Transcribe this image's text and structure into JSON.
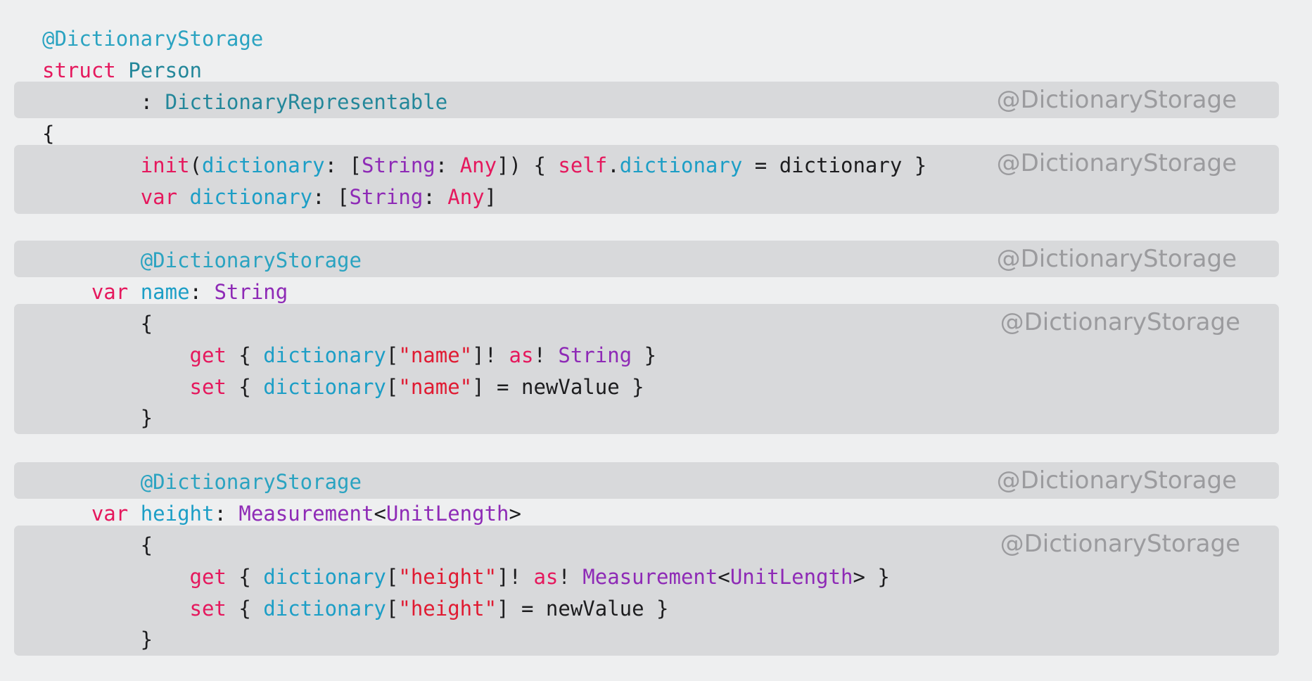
{
  "annotation_label": "@DictionaryStorage",
  "colors": {
    "background": "#eeeff0",
    "band": "#d8d9db",
    "attribute": "#2aa3c1",
    "keyword": "#e5185d",
    "type": "#23879a",
    "property": "#1c9ec6",
    "stdlib_type": "#8e2ab6",
    "string": "#e01b32",
    "plain": "#1d1d1f",
    "annotation": "#9b9b9e"
  },
  "bands": [
    {
      "name": "conformance-band",
      "tag": "@DictionaryStorage"
    },
    {
      "name": "members-band",
      "tag": "@DictionaryStorage"
    },
    {
      "name": "name-attribute-band",
      "tag": "@DictionaryStorage"
    },
    {
      "name": "name-accessor-band",
      "tag": "@DictionaryStorage"
    },
    {
      "name": "height-attribute-band",
      "tag": "@DictionaryStorage"
    },
    {
      "name": "height-accessor-band",
      "tag": "@DictionaryStorage"
    }
  ],
  "lines": [
    {
      "name": "line-attribute",
      "tokens": [
        {
          "t": "@DictionaryStorage",
          "k": "attr"
        }
      ]
    },
    {
      "name": "line-struct-decl",
      "tokens": [
        {
          "t": "struct",
          "k": "kw"
        },
        {
          "t": " ",
          "k": "plain"
        },
        {
          "t": "Person",
          "k": "type"
        }
      ]
    },
    {
      "name": "line-conformance",
      "tokens": [
        {
          "t": "        : ",
          "k": "plain"
        },
        {
          "t": "DictionaryRepresentable",
          "k": "type"
        }
      ]
    },
    {
      "name": "line-open-brace",
      "tokens": [
        {
          "t": "{",
          "k": "plain"
        }
      ]
    },
    {
      "name": "line-init",
      "tokens": [
        {
          "t": "        ",
          "k": "plain"
        },
        {
          "t": "init",
          "k": "kw"
        },
        {
          "t": "(",
          "k": "plain"
        },
        {
          "t": "dictionary",
          "k": "prop"
        },
        {
          "t": ": [",
          "k": "plain"
        },
        {
          "t": "String",
          "k": "std"
        },
        {
          "t": ": ",
          "k": "plain"
        },
        {
          "t": "Any",
          "k": "kw"
        },
        {
          "t": "]) { ",
          "k": "plain"
        },
        {
          "t": "self",
          "k": "kw"
        },
        {
          "t": ".",
          "k": "plain"
        },
        {
          "t": "dictionary",
          "k": "prop"
        },
        {
          "t": " = dictionary }",
          "k": "plain"
        }
      ]
    },
    {
      "name": "line-var-dictionary",
      "tokens": [
        {
          "t": "        ",
          "k": "plain"
        },
        {
          "t": "var",
          "k": "kw"
        },
        {
          "t": " ",
          "k": "plain"
        },
        {
          "t": "dictionary",
          "k": "prop"
        },
        {
          "t": ": [",
          "k": "plain"
        },
        {
          "t": "String",
          "k": "std"
        },
        {
          "t": ": ",
          "k": "plain"
        },
        {
          "t": "Any",
          "k": "kw"
        },
        {
          "t": "]",
          "k": "plain"
        }
      ]
    },
    {
      "name": "line-name-attribute",
      "tokens": [
        {
          "t": "        ",
          "k": "plain"
        },
        {
          "t": "@DictionaryStorage",
          "k": "attr"
        }
      ]
    },
    {
      "name": "line-var-name",
      "tokens": [
        {
          "t": "    ",
          "k": "plain"
        },
        {
          "t": "var",
          "k": "kw"
        },
        {
          "t": " ",
          "k": "plain"
        },
        {
          "t": "name",
          "k": "prop"
        },
        {
          "t": ": ",
          "k": "plain"
        },
        {
          "t": "String",
          "k": "std"
        }
      ]
    },
    {
      "name": "line-name-open",
      "tokens": [
        {
          "t": "        {",
          "k": "plain"
        }
      ]
    },
    {
      "name": "line-name-get",
      "tokens": [
        {
          "t": "            ",
          "k": "plain"
        },
        {
          "t": "get",
          "k": "kw"
        },
        {
          "t": " { ",
          "k": "plain"
        },
        {
          "t": "dictionary",
          "k": "prop"
        },
        {
          "t": "[",
          "k": "plain"
        },
        {
          "t": "\"name\"",
          "k": "str"
        },
        {
          "t": "]! ",
          "k": "plain"
        },
        {
          "t": "as",
          "k": "kw"
        },
        {
          "t": "! ",
          "k": "plain"
        },
        {
          "t": "String",
          "k": "std"
        },
        {
          "t": " }",
          "k": "plain"
        }
      ]
    },
    {
      "name": "line-name-set",
      "tokens": [
        {
          "t": "            ",
          "k": "plain"
        },
        {
          "t": "set",
          "k": "kw"
        },
        {
          "t": " { ",
          "k": "plain"
        },
        {
          "t": "dictionary",
          "k": "prop"
        },
        {
          "t": "[",
          "k": "plain"
        },
        {
          "t": "\"name\"",
          "k": "str"
        },
        {
          "t": "] = newValue }",
          "k": "plain"
        }
      ]
    },
    {
      "name": "line-name-close",
      "tokens": [
        {
          "t": "        }",
          "k": "plain"
        }
      ]
    },
    {
      "name": "line-height-attribute",
      "tokens": [
        {
          "t": "        ",
          "k": "plain"
        },
        {
          "t": "@DictionaryStorage",
          "k": "attr"
        }
      ]
    },
    {
      "name": "line-var-height",
      "tokens": [
        {
          "t": "    ",
          "k": "plain"
        },
        {
          "t": "var",
          "k": "kw"
        },
        {
          "t": " ",
          "k": "plain"
        },
        {
          "t": "height",
          "k": "prop"
        },
        {
          "t": ": ",
          "k": "plain"
        },
        {
          "t": "Measurement",
          "k": "std"
        },
        {
          "t": "<",
          "k": "plain"
        },
        {
          "t": "UnitLength",
          "k": "std"
        },
        {
          "t": ">",
          "k": "plain"
        }
      ]
    },
    {
      "name": "line-height-open",
      "tokens": [
        {
          "t": "        {",
          "k": "plain"
        }
      ]
    },
    {
      "name": "line-height-get",
      "tokens": [
        {
          "t": "            ",
          "k": "plain"
        },
        {
          "t": "get",
          "k": "kw"
        },
        {
          "t": " { ",
          "k": "plain"
        },
        {
          "t": "dictionary",
          "k": "prop"
        },
        {
          "t": "[",
          "k": "plain"
        },
        {
          "t": "\"height\"",
          "k": "str"
        },
        {
          "t": "]! ",
          "k": "plain"
        },
        {
          "t": "as",
          "k": "kw"
        },
        {
          "t": "! ",
          "k": "plain"
        },
        {
          "t": "Measurement",
          "k": "std"
        },
        {
          "t": "<",
          "k": "plain"
        },
        {
          "t": "UnitLength",
          "k": "std"
        },
        {
          "t": "> }",
          "k": "plain"
        }
      ]
    },
    {
      "name": "line-height-set",
      "tokens": [
        {
          "t": "            ",
          "k": "plain"
        },
        {
          "t": "set",
          "k": "kw"
        },
        {
          "t": " { ",
          "k": "plain"
        },
        {
          "t": "dictionary",
          "k": "prop"
        },
        {
          "t": "[",
          "k": "plain"
        },
        {
          "t": "\"height\"",
          "k": "str"
        },
        {
          "t": "] = newValue }",
          "k": "plain"
        }
      ]
    },
    {
      "name": "line-height-close",
      "tokens": [
        {
          "t": "        }",
          "k": "plain"
        }
      ]
    }
  ]
}
